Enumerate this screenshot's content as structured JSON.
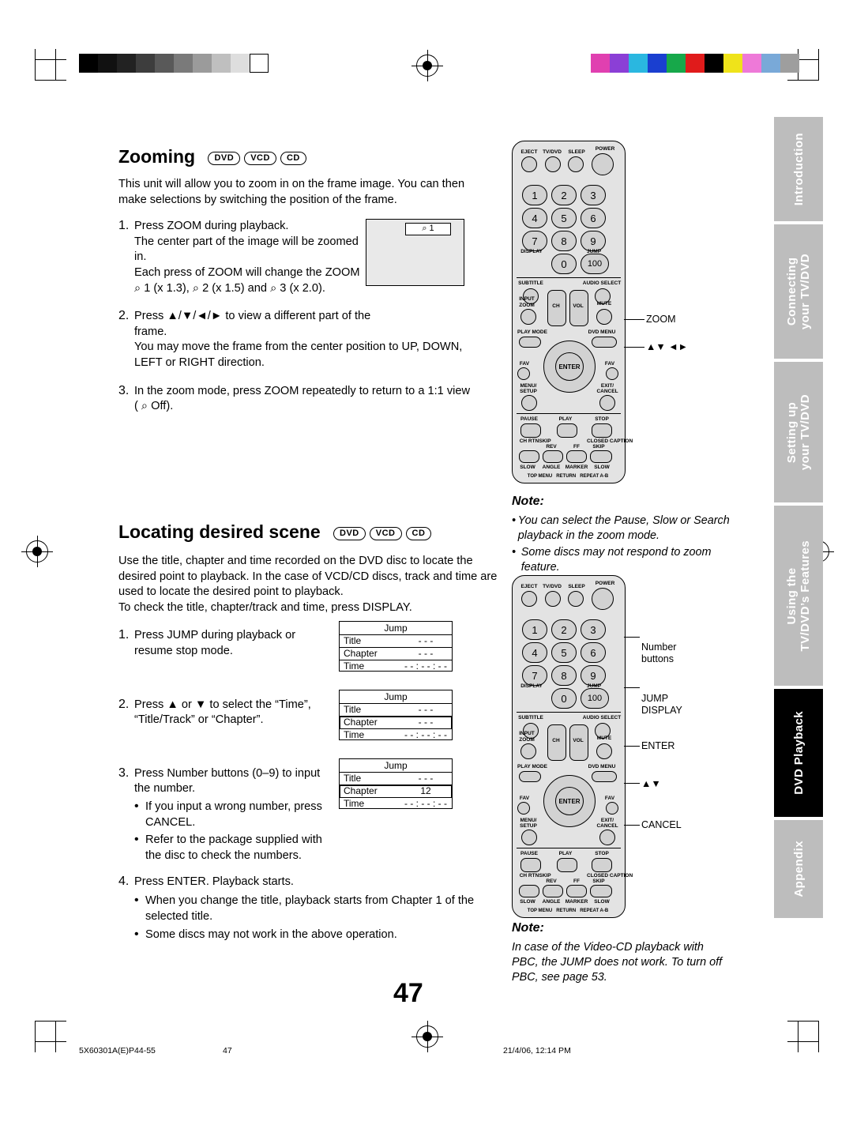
{
  "page": {
    "number": "47",
    "footer_left": "5X60301A(E)P44-55",
    "footer_center": "47",
    "footer_right": "21/4/06, 12:14 PM"
  },
  "side_tabs": [
    {
      "label": "Introduction",
      "dark": false
    },
    {
      "label": "Connecting\nyour TV/DVD",
      "dark": false
    },
    {
      "label": "Setting up\nyour TV/DVD",
      "dark": false
    },
    {
      "label": "Using the\nTV/DVD’s Features",
      "dark": false
    },
    {
      "label": "DVD Playback",
      "dark": true
    },
    {
      "label": "Appendix",
      "dark": false
    }
  ],
  "section_zooming": {
    "title": "Zooming",
    "discs": [
      "DVD",
      "VCD",
      "CD"
    ],
    "intro": "This unit will allow you to zoom in on the frame image. You can then make selections by switching the position of the frame.",
    "steps": [
      {
        "n": "1.",
        "lines": [
          "Press ZOOM during playback.",
          "The center part of the image will be zoomed in.",
          "Each press of ZOOM will change the ZOOM",
          "⌕ 1 (x 1.3), ⌕ 2 (x 1.5) and ⌕ 3 (x 2.0)."
        ]
      },
      {
        "n": "2.",
        "lines": [
          "Press ▲/▼/◄/► to view a different part of the frame.",
          "You may move the frame from the center position to UP, DOWN, LEFT or RIGHT direction."
        ]
      },
      {
        "n": "3.",
        "lines": [
          "In the zoom mode, press ZOOM repeatedly to return to a 1:1 view",
          "( ⌕ Off)."
        ]
      }
    ],
    "zoom_frame_label": "⌕ 1"
  },
  "section_locating": {
    "title": "Locating desired scene",
    "discs": [
      "DVD",
      "VCD",
      "CD"
    ],
    "intro": "Use the title, chapter and time recorded on the DVD disc to locate the desired point to playback. In the case of VCD/CD discs, track and time are used to locate the desired point to playback.\nTo check the title, chapter/track and time, press DISPLAY.",
    "steps": [
      {
        "n": "1.",
        "text": "Press JUMP during playback or resume stop mode."
      },
      {
        "n": "2.",
        "text": "Press ▲ or ▼ to select the “Time”, “Title/Track” or “Chapter”."
      },
      {
        "n": "3.",
        "text": "Press Number buttons (0–9) to input the number.",
        "bullets": [
          "If you input a wrong number, press CANCEL.",
          "Refer to the package supplied with the disc to check the numbers."
        ]
      },
      {
        "n": "4.",
        "text": "Press ENTER. Playback starts.",
        "bullets": [
          "When you change the title, playback starts from Chapter 1 of the selected title.",
          "Some discs may not work in the above operation."
        ]
      }
    ],
    "jump_tables": [
      {
        "title": "Jump",
        "rows": [
          {
            "label": "Title",
            "value": "- - -",
            "highlight": false
          },
          {
            "label": "Chapter",
            "value": "- - -",
            "highlight": false
          },
          {
            "label": "Time",
            "value": "- - : - - : - -",
            "highlight": false
          }
        ]
      },
      {
        "title": "Jump",
        "rows": [
          {
            "label": "Title",
            "value": "- - -",
            "highlight": false
          },
          {
            "label": "Chapter",
            "value": "- - -",
            "highlight": true
          },
          {
            "label": "Time",
            "value": "- - : - - : - -",
            "highlight": false
          }
        ]
      },
      {
        "title": "Jump",
        "rows": [
          {
            "label": "Title",
            "value": "- - -",
            "highlight": false
          },
          {
            "label": "Chapter",
            "value": "12",
            "highlight": true
          },
          {
            "label": "Time",
            "value": "- - : - - : - -",
            "highlight": false
          }
        ]
      }
    ]
  },
  "note_top": {
    "heading": "Note:",
    "items": [
      "You can select the Pause, Slow or Search playback in the zoom mode.",
      "Some discs may not respond to zoom feature."
    ]
  },
  "note_bottom": {
    "heading": "Note:",
    "text": "In case of the Video-CD playback with PBC, the JUMP does not work. To turn off PBC, see page 53."
  },
  "remote_top": {
    "callouts": [
      {
        "label": "ZOOM"
      },
      {
        "label": "▲▼ ◄►"
      }
    ],
    "top_row": [
      "EJECT",
      "TV/DVD",
      "SLEEP",
      "POWER"
    ],
    "numbers": [
      "1",
      "2",
      "3",
      "4",
      "5",
      "6",
      "7",
      "8",
      "9",
      "0",
      "100"
    ],
    "labels": [
      "DISPLAY",
      "JUMP",
      "SUBTITLE",
      "AUDIO SELECT",
      "INPUT",
      "ZOOM",
      "CH",
      "VOL",
      "MUTE",
      "PLAY MODE",
      "DVD MENU",
      "FAV",
      "ENTER",
      "FAV",
      "MENU/SETUP",
      "EXIT/CANCEL",
      "PAUSE",
      "PLAY",
      "STOP",
      "CH RTN",
      "REV",
      "FF",
      "CLOSED CAPTION",
      "SKIP",
      "SKIP",
      "SLOW",
      "ANGLE",
      "MARKER",
      "SLOW",
      "TOP MENU",
      "RETURN",
      "REPEAT A-B"
    ]
  },
  "remote_bottom": {
    "callouts": [
      {
        "label": "Number\nbuttons"
      },
      {
        "label": "JUMP\nDISPLAY"
      },
      {
        "label": "ENTER"
      },
      {
        "label": "▲▼"
      },
      {
        "label": "CANCEL"
      }
    ]
  }
}
